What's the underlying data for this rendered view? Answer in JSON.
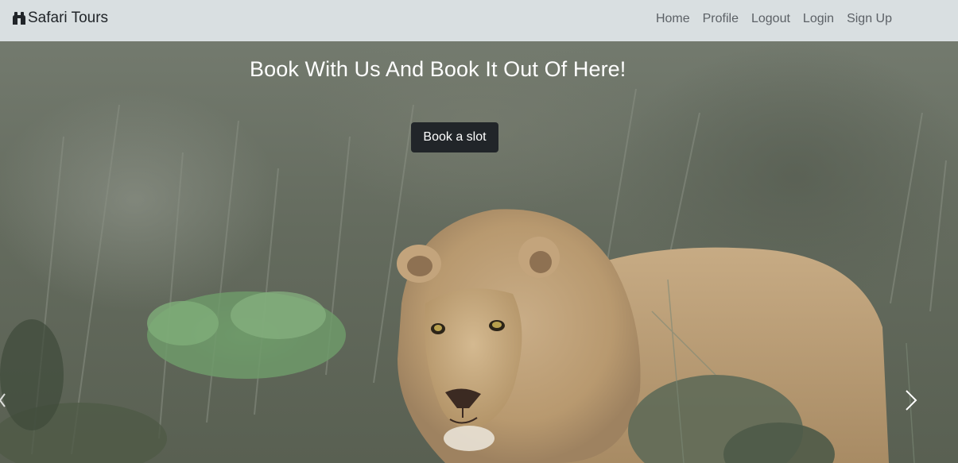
{
  "navbar": {
    "brand": {
      "icon": "binoculars-icon",
      "label": "Safari Tours"
    },
    "links": [
      {
        "label": "Home"
      },
      {
        "label": "Profile"
      },
      {
        "label": "Logout"
      },
      {
        "label": "Login"
      },
      {
        "label": "Sign Up"
      }
    ],
    "background": "#d9dfe1"
  },
  "hero": {
    "title": "Book With Us And Book It Out Of Here!",
    "cta_label": "Book a slot",
    "image": "lion-in-bush-photo",
    "controls": {
      "next_icon": "chevron-right-icon",
      "prev_icon": "chevron-left-icon"
    }
  },
  "colors": {
    "button": "#212529",
    "title": "#ffffff",
    "nav_text": "#5c6166"
  }
}
